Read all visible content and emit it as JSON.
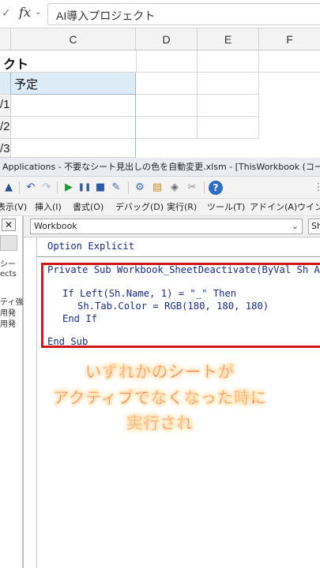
{
  "formula_bar": {
    "check_icon": "checkmark-icon",
    "fx_label": "fx",
    "value": "AI導入プロジェクト"
  },
  "grid": {
    "columns": [
      "C",
      "D",
      "E",
      "F"
    ],
    "title_cell": "クト",
    "header_cell": "予定",
    "rows": [
      "/1",
      "/2",
      "/3"
    ],
    "header_fill": "#ddebf7"
  },
  "vbe": {
    "title": "Applications - 不要なシート見出しの色を自動変更.xlsm - [ThisWorkbook (コード)]",
    "menu": [
      "表示(V)",
      "挿入(I)",
      "書式(O)",
      "デバッグ(D)",
      "実行(R)",
      "ツール(T)",
      "アドイン(A)",
      "ウインドウ"
    ],
    "object_combo": "Workbook",
    "proc_combo": "Sh",
    "left_pane": {
      "close": "✕",
      "lines": [
        "シー",
        "ects",
        "ティ強",
        "用発",
        "用発"
      ]
    },
    "code": {
      "l1": "Option Explicit",
      "l2": "Private Sub Workbook_SheetDeactivate(ByVal Sh As",
      "l3": "If Left(Sh.Name, 1) = \"_\" Then",
      "l4": "Sh.Tab.Color = RGB(180, 180, 180)",
      "l5": "End If",
      "l6": "End Sub"
    }
  },
  "caption": {
    "line1": "いずれかのシートが",
    "line2": "アクティブでなくなった時に",
    "line3": "実行され"
  },
  "colors": {
    "highlight": "#d01818",
    "caption_text": "#e8180c",
    "code_text": "#1a2a86"
  }
}
